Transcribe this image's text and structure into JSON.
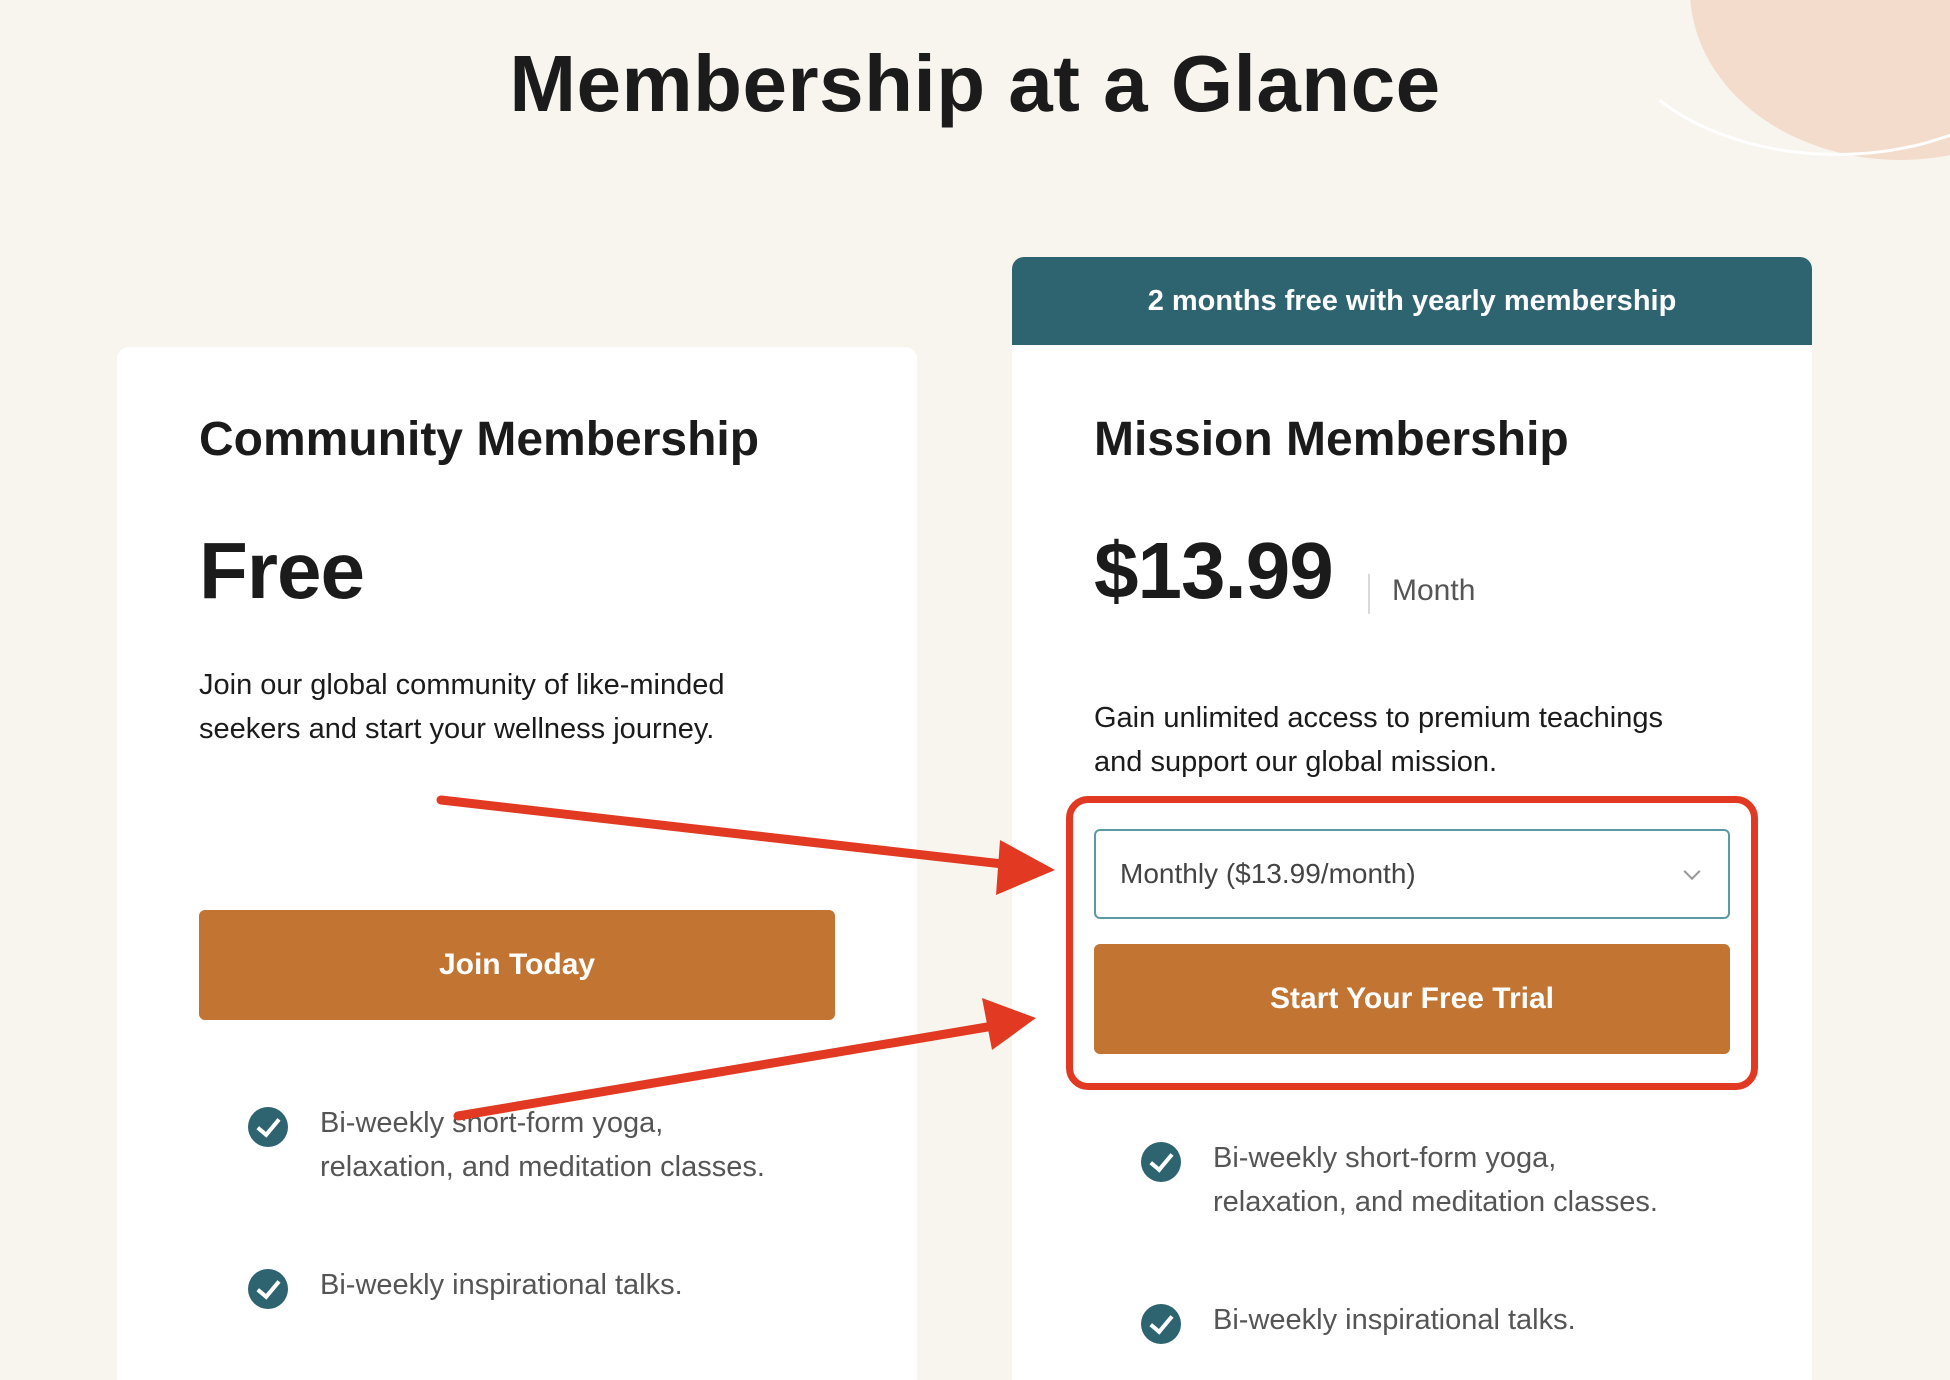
{
  "page": {
    "title": "Membership at a Glance"
  },
  "community": {
    "title": "Community Membership",
    "price": "Free",
    "description_line1": "Join our global community of like-minded",
    "description_line2": "seekers and start your wellness journey.",
    "button_label": "Join Today",
    "features": [
      "Bi-weekly short-form yoga,\nrelaxation, and meditation classes.",
      "Bi-weekly inspirational talks."
    ]
  },
  "mission": {
    "promo_banner": "2 months free with yearly membership",
    "title": "Mission Membership",
    "price": "$13.99",
    "price_period": "Month",
    "description_line1": "Gain unlimited access to premium teachings",
    "description_line2": "and support our global mission.",
    "plan_select": {
      "selected": "Monthly ($13.99/month)"
    },
    "button_label": "Start Your Free Trial",
    "features": [
      "Bi-weekly short-form yoga,\nrelaxation, and meditation classes.",
      "Bi-weekly inspirational talks."
    ]
  },
  "colors": {
    "background": "#f8f5ef",
    "accent_teal": "#2e6370",
    "button_orange": "#c27432",
    "annotation_red": "#e23a22"
  },
  "icons": {
    "feature_check": "check-circle-icon",
    "select_chevron": "chevron-down-icon"
  }
}
